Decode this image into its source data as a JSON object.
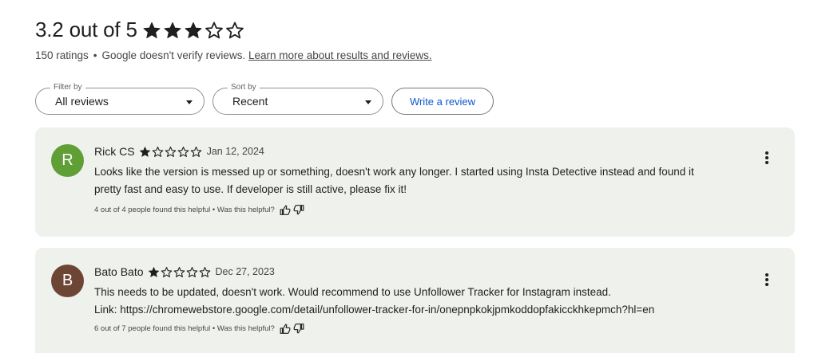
{
  "summary": {
    "rating_text": "3.2 out of 5",
    "rating_value": 3.2,
    "stars_max": 5,
    "ratings_count": "150 ratings",
    "separator": "•",
    "verify_note": "Google doesn't verify reviews.",
    "learn_more_link": "Learn more about results and reviews."
  },
  "controls": {
    "filter": {
      "legend": "Filter by",
      "value": "All reviews"
    },
    "sort": {
      "legend": "Sort by",
      "value": "Recent"
    },
    "write_review_label": "Write a review"
  },
  "reviews": [
    {
      "avatar_letter": "R",
      "avatar_color": "#5f9f35",
      "name": "Rick CS",
      "stars": 1,
      "date": "Jan 12, 2024",
      "text_lines": [
        "Looks like the version is messed up or something, doesn't work any longer. I started using Insta Detective instead and found it",
        "pretty fast and easy to use. If developer is still active, please fix it!"
      ],
      "helpful_text": "4 out of 4 people found this helpful • Was this helpful?"
    },
    {
      "avatar_letter": "B",
      "avatar_color": "#6d4535",
      "name": "Bato Bato",
      "stars": 1,
      "date": "Dec 27, 2023",
      "text_lines": [
        "This needs to be updated, doesn't work. Would recommend to use Unfollower Tracker for Instagram instead.",
        "Link: https://chromewebstore.google.com/detail/unfollower-tracker-for-in/onepnpkokjpmkoddopfakicckhkepmch?hl=en"
      ],
      "helpful_text": "6 out of 7 people found this helpful • Was this helpful?"
    }
  ],
  "icons": {
    "star_filled": "star-filled-icon",
    "star_outline": "star-outline-icon",
    "thumb_up": "thumb-up-icon",
    "thumb_down": "thumb-down-icon",
    "more": "more-vert-icon"
  },
  "colors": {
    "star": "#1f1f1f",
    "card_background": "#eff1ed",
    "link_blue": "#0b57d0"
  }
}
